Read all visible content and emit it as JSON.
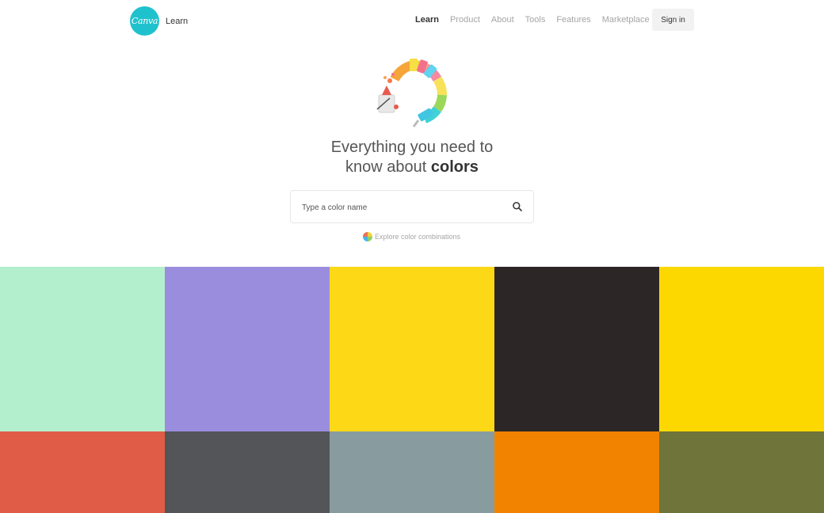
{
  "header": {
    "logo_text": "Canva",
    "brand_label": "Learn",
    "nav": [
      {
        "label": "Learn",
        "active": true
      },
      {
        "label": "Product",
        "active": false
      },
      {
        "label": "About",
        "active": false
      },
      {
        "label": "Tools",
        "active": false
      },
      {
        "label": "Features",
        "active": false
      },
      {
        "label": "Marketplace",
        "active": false
      }
    ],
    "signin_label": "Sign in"
  },
  "hero": {
    "headline_line1": "Everything you need to",
    "headline_line2_prefix": "know about ",
    "headline_line2_bold": "colors",
    "search_placeholder": "Type a color name",
    "search_value": "",
    "explore_label": "Explore color combinations"
  },
  "colors": {
    "brand": "#1fc2cc",
    "swatches": [
      "#b3efcd",
      "#9b8ddd",
      "#fcd817",
      "#2d2626",
      "#fcd800",
      "#e05c47",
      "#535559",
      "#889ca0",
      "#f28300",
      "#6e743a"
    ]
  }
}
